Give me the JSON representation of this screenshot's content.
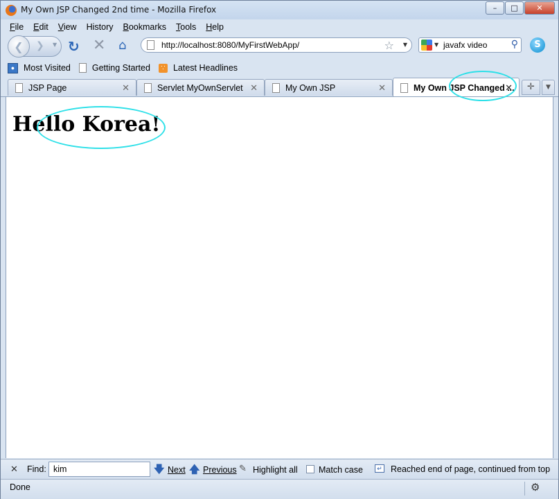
{
  "window": {
    "title": "My Own JSP Changed 2nd time - Mozilla Firefox",
    "icon": "firefox-icon",
    "buttons": {
      "minimize": "–",
      "maximize": "□",
      "close": "✕"
    }
  },
  "menubar": {
    "items": [
      {
        "mnemonic": "F",
        "rest": "ile"
      },
      {
        "mnemonic": "E",
        "rest": "dit"
      },
      {
        "mnemonic": "V",
        "rest": "iew"
      },
      {
        "mnemonic": "H",
        "rest": "istory",
        "prefix": ""
      },
      {
        "mnemonic": "B",
        "rest": "ookmarks"
      },
      {
        "mnemonic": "T",
        "rest": "ools"
      },
      {
        "mnemonic": "H",
        "rest": "elp"
      }
    ]
  },
  "navbar": {
    "url": "http://localhost:8080/MyFirstWebApp/",
    "search_value": "javafx video",
    "search_engine_icon": "google-icon",
    "skype_label": "S"
  },
  "bookmarks": [
    {
      "label": "Most Visited",
      "icon": "most-visited-icon"
    },
    {
      "label": "Getting Started",
      "icon": "page-icon"
    },
    {
      "label": "Latest Headlines",
      "icon": "rss-feed-icon"
    }
  ],
  "tabs": [
    {
      "label": "JSP Page",
      "active": false
    },
    {
      "label": "Servlet MyOwnServlet",
      "active": false
    },
    {
      "label": "My Own JSP",
      "active": false
    },
    {
      "label": "My Own JSP Changed ...",
      "active": true
    }
  ],
  "content": {
    "heading": "Hello Korea!"
  },
  "annotations": {
    "color": "#2de0e8"
  },
  "findbar": {
    "close": "✕",
    "label": "Find:",
    "value": "kim",
    "next": "Next",
    "previous": "Previous",
    "highlight_all": "Highlight all",
    "match_case": "Match case",
    "match_case_checked": false,
    "status": "Reached end of page, continued from top"
  },
  "statusbar": {
    "text": "Done"
  }
}
